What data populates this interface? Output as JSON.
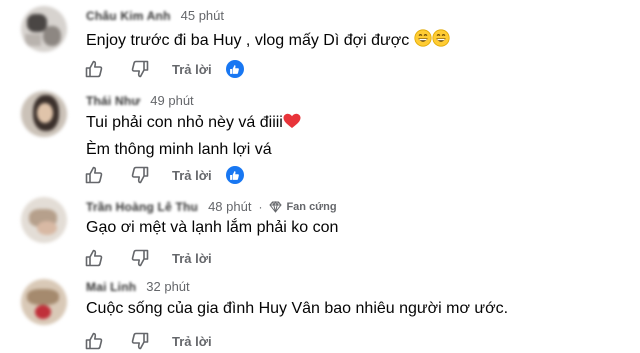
{
  "comments": [
    {
      "author": "Châu Kim Anh",
      "time": "45 phút",
      "lines": [
        "Enjoy trước đi ba Huy , vlog mấy Dì đợi được"
      ],
      "emoji": "grinning-face-with-smiling-eyes x2",
      "reply_label": "Trả lời"
    },
    {
      "author": "Thái Như",
      "time": "49 phút",
      "lines": [
        "Tui phải con nhỏ nèy vá điiii",
        "Èm thông minh lanh lợi vá"
      ],
      "emoji": "red-heart",
      "reply_label": "Trả lời"
    },
    {
      "author": "Trần Hoàng Lê Thu",
      "time": "48 phút",
      "badge": "Fan cứng",
      "lines": [
        "Gạo ơi mệt và lạnh lắm phải ko con"
      ],
      "reply_label": "Trả lời"
    },
    {
      "author": "Mai Linh",
      "time": "32 phút",
      "lines": [
        "Cuộc sống của gia đình Huy Vân bao nhiêu người mơ ước."
      ],
      "reply_label": "Trả lời"
    }
  ],
  "colors": {
    "accent": "#1877f2",
    "muted": "#65676b",
    "text": "#050505"
  }
}
